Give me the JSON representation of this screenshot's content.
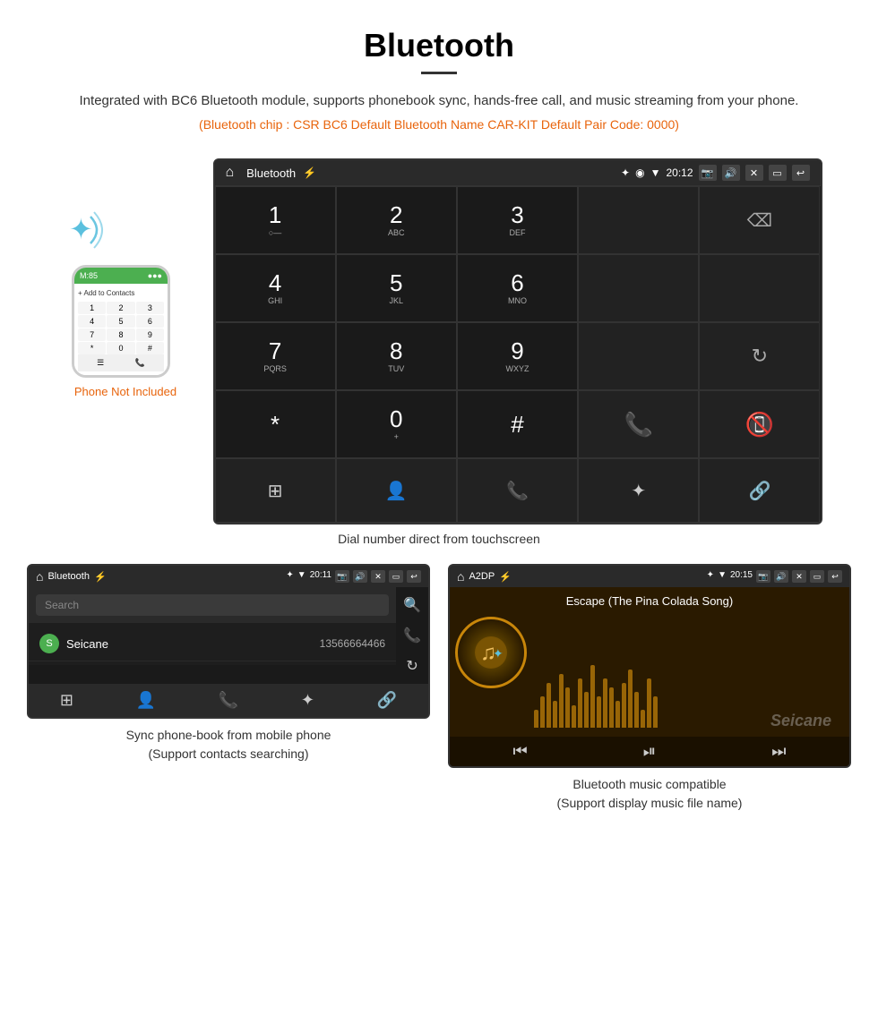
{
  "page": {
    "title": "Bluetooth",
    "description": "Integrated with BC6 Bluetooth module, supports phonebook sync, hands-free call, and music streaming from your phone.",
    "specs": "(Bluetooth chip : CSR BC6   Default Bluetooth Name CAR-KIT    Default Pair Code: 0000)"
  },
  "dial_screen": {
    "statusbar": {
      "title": "Bluetooth",
      "time": "20:12"
    },
    "keys": [
      {
        "num": "1",
        "letters": "○—"
      },
      {
        "num": "2",
        "letters": "ABC"
      },
      {
        "num": "3",
        "letters": "DEF"
      },
      {
        "num": "4",
        "letters": "GHI"
      },
      {
        "num": "5",
        "letters": "JKL"
      },
      {
        "num": "6",
        "letters": "MNO"
      },
      {
        "num": "7",
        "letters": "PQRS"
      },
      {
        "num": "8",
        "letters": "TUV"
      },
      {
        "num": "9",
        "letters": "WXYZ"
      },
      {
        "num": "*",
        "letters": ""
      },
      {
        "num": "0",
        "letters": "+"
      },
      {
        "num": "#",
        "letters": ""
      }
    ],
    "caption": "Dial number direct from touchscreen"
  },
  "phone_illustration": {
    "not_included": "Phone Not Included"
  },
  "contacts_screen": {
    "statusbar_title": "Bluetooth",
    "statusbar_time": "20:11",
    "search_placeholder": "Search",
    "contact": {
      "letter": "S",
      "name": "Seicane",
      "number": "13566664466"
    },
    "caption_line1": "Sync phone-book from mobile phone",
    "caption_line2": "(Support contacts searching)"
  },
  "music_screen": {
    "statusbar_title": "A2DP",
    "statusbar_time": "20:15",
    "song_title": "Escape (The Pina Colada Song)",
    "caption_line1": "Bluetooth music compatible",
    "caption_line2": "(Support display music file name)"
  },
  "colors": {
    "accent_orange": "#e8640c",
    "green": "#4caf50",
    "call_green": "#4caf50",
    "call_red": "#f44336",
    "gold": "#c8860a"
  }
}
